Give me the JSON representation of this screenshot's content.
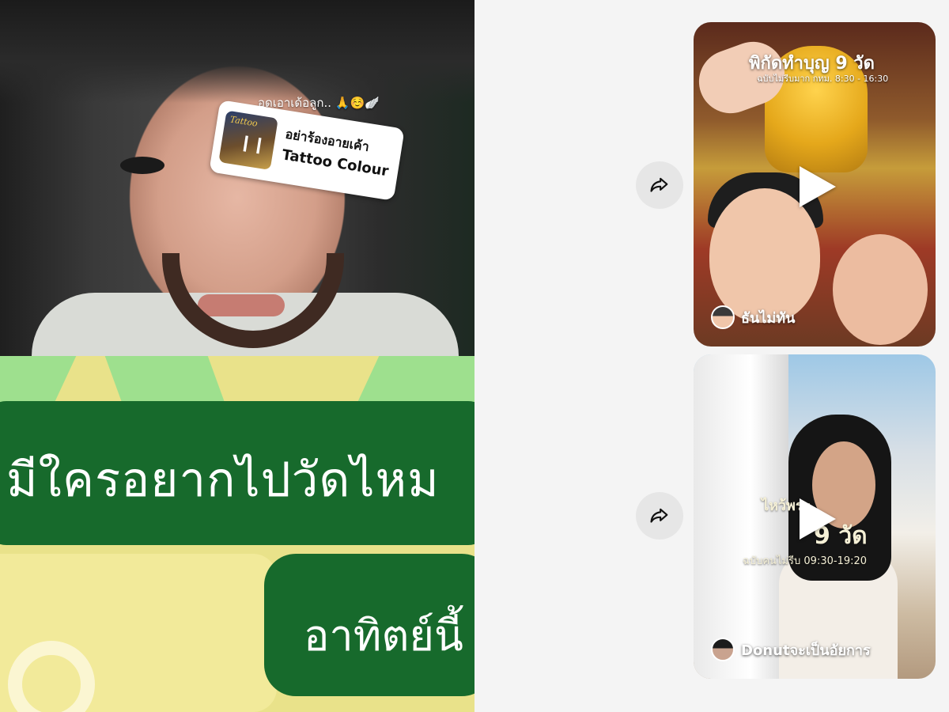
{
  "left_story": {
    "caption": "อดเอาเด้อลูก.. 🙏☺️🪽",
    "sticker_logo": "Tattoo",
    "sticker_song": "อย่าร้องอายเค้า",
    "sticker_artist": "Tattoo Colour"
  },
  "promo": {
    "line1": "มีใครอยากไปวัดไหม",
    "line2": "อาทิตย์นี้"
  },
  "feed": {
    "cards": [
      {
        "overlay_title": "พิกัดทำบุญ 9 วัด",
        "overlay_sub": "ฉบับไม่รีบมาก กทม. 8:30 - 16:30",
        "author": "ธันไม่ทัน"
      },
      {
        "overlay_a": "ไหว้พระ",
        "overlay_b": "9 วัด",
        "overlay_c": "ฉบับคนไม่รีบ 09:30-19:20",
        "author": "Donutจะเป็นอัยการ"
      }
    ]
  },
  "colors": {
    "promo_green": "#176a2c",
    "promo_yellow": "#e9e28a",
    "page_bg": "#f4f4f4"
  },
  "icons": [
    "share-icon",
    "play-icon"
  ]
}
